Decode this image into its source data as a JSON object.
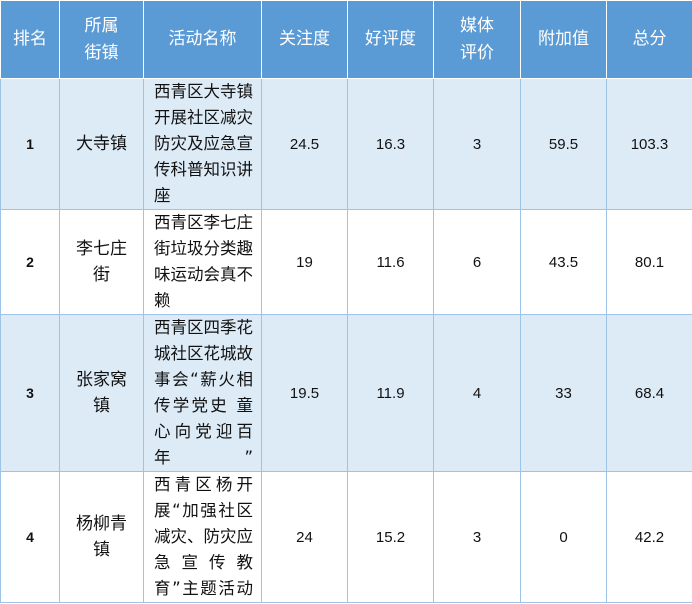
{
  "headers": {
    "rank": "排名",
    "town": "所属街镇",
    "activity": "活动名称",
    "attention": "关注度",
    "rating": "好评度",
    "media": "媒体评价",
    "bonus": "附加值",
    "total": "总分"
  },
  "rows": [
    {
      "rank": "1",
      "town": "大寺镇",
      "activity": "西青区大寺镇开展社区减灾防灾及应急宣传科普知识讲座",
      "attention": "24.5",
      "rating": "16.3",
      "media": "3",
      "bonus": "59.5",
      "total": "103.3"
    },
    {
      "rank": "2",
      "town": "李七庄街",
      "activity": "西青区李七庄街垃圾分类趣味运动会真不赖",
      "attention": "19",
      "rating": "11.6",
      "media": "6",
      "bonus": "43.5",
      "total": "80.1"
    },
    {
      "rank": "3",
      "town": "张家窝镇",
      "activity": "西青区四季花城社区花城故事会“薪火相传学党史 童心向党迎百年”",
      "attention": "19.5",
      "rating": "11.9",
      "media": "4",
      "bonus": "33",
      "total": "68.4"
    },
    {
      "rank": "4",
      "town": "杨柳青镇",
      "activity": "西青区杨开展“加强社区减灾、防灾应急宣传教育”主题活动",
      "attention": "24",
      "rating": "15.2",
      "media": "3",
      "bonus": "0",
      "total": "42.2"
    }
  ]
}
